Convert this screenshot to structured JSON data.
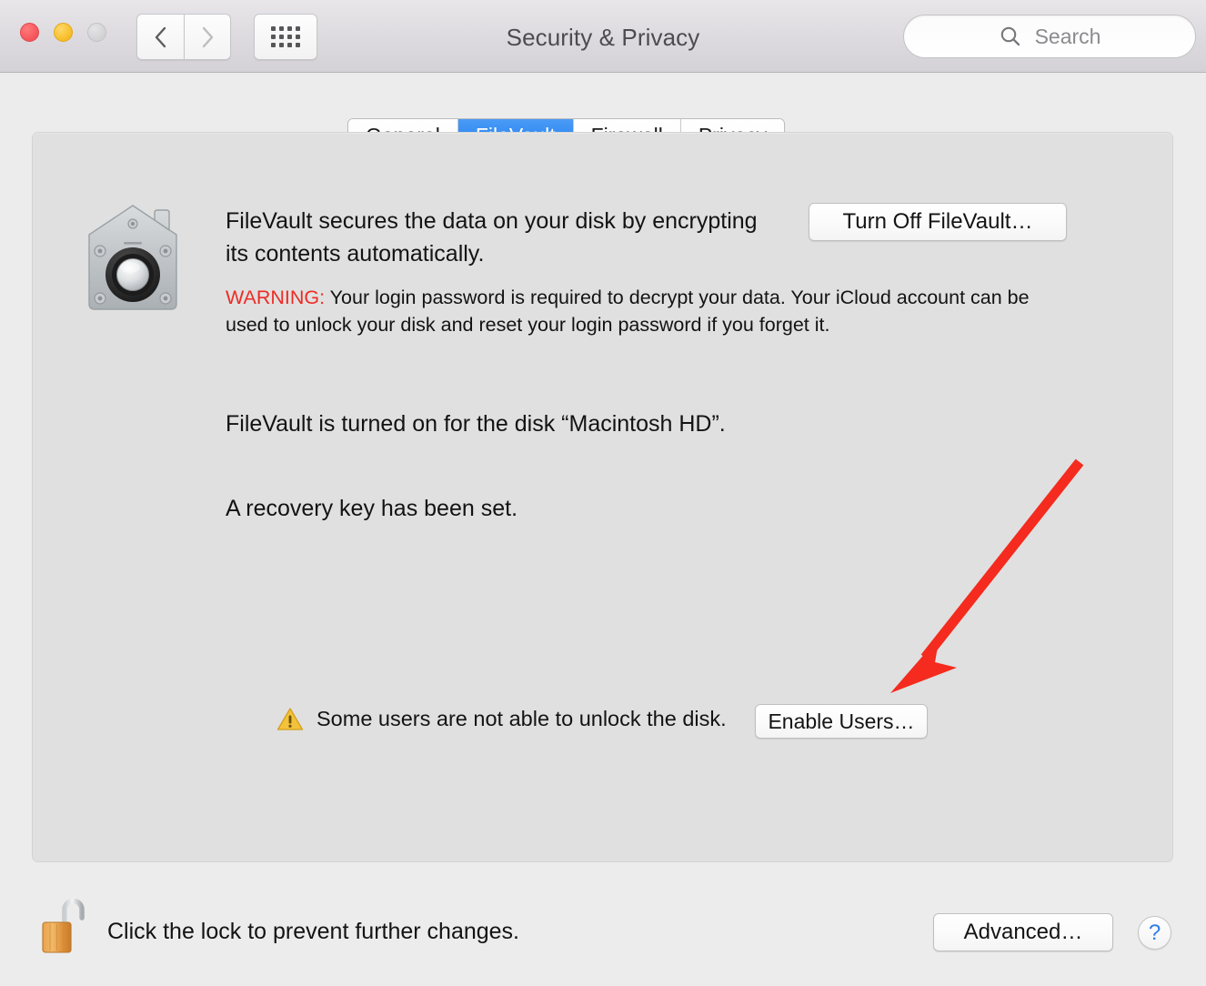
{
  "window": {
    "title": "Security & Privacy",
    "traffic_lights": [
      {
        "name": "close",
        "color": "#f4545a"
      },
      {
        "name": "minimize",
        "color": "#f6bc26"
      },
      {
        "name": "zoom",
        "color": "#d2d2d5"
      }
    ],
    "nav": {
      "back_label": "‹",
      "forward_label": "›",
      "show_all_label": "Show All"
    }
  },
  "search": {
    "placeholder": "Search",
    "value": "",
    "icon": "search-icon"
  },
  "tabs": [
    {
      "label": "General",
      "active": false
    },
    {
      "label": "FileVault",
      "active": true
    },
    {
      "label": "Firewall",
      "active": false
    },
    {
      "label": "Privacy",
      "active": false
    }
  ],
  "main": {
    "icon": "filevault-vault-icon",
    "intro_text": "FileVault secures the data on your disk by encrypting its contents automatically.",
    "warning_label": "WARNING:",
    "warning_text": " Your login password is required to decrypt your data. Your iCloud account can be used to unlock your disk and reset your login password if you forget it.",
    "status_line_1": "FileVault is turned on for the disk “Macintosh HD”.",
    "status_line_2": "A recovery key has been set.",
    "turn_off_button": "Turn Off FileVault…",
    "users_warning_icon": "warning-triangle-icon",
    "users_warning_text": "Some users are not able to unlock the disk.",
    "enable_users_button": "Enable Users…"
  },
  "footer": {
    "lock_icon": "unlocked-padlock-icon",
    "lock_label": "Click the lock to prevent further changes.",
    "advanced_button": "Advanced…",
    "help_button": "?"
  },
  "annotation": {
    "type": "arrow",
    "color": "#f42b1e",
    "points_to": "enable-users-button"
  }
}
